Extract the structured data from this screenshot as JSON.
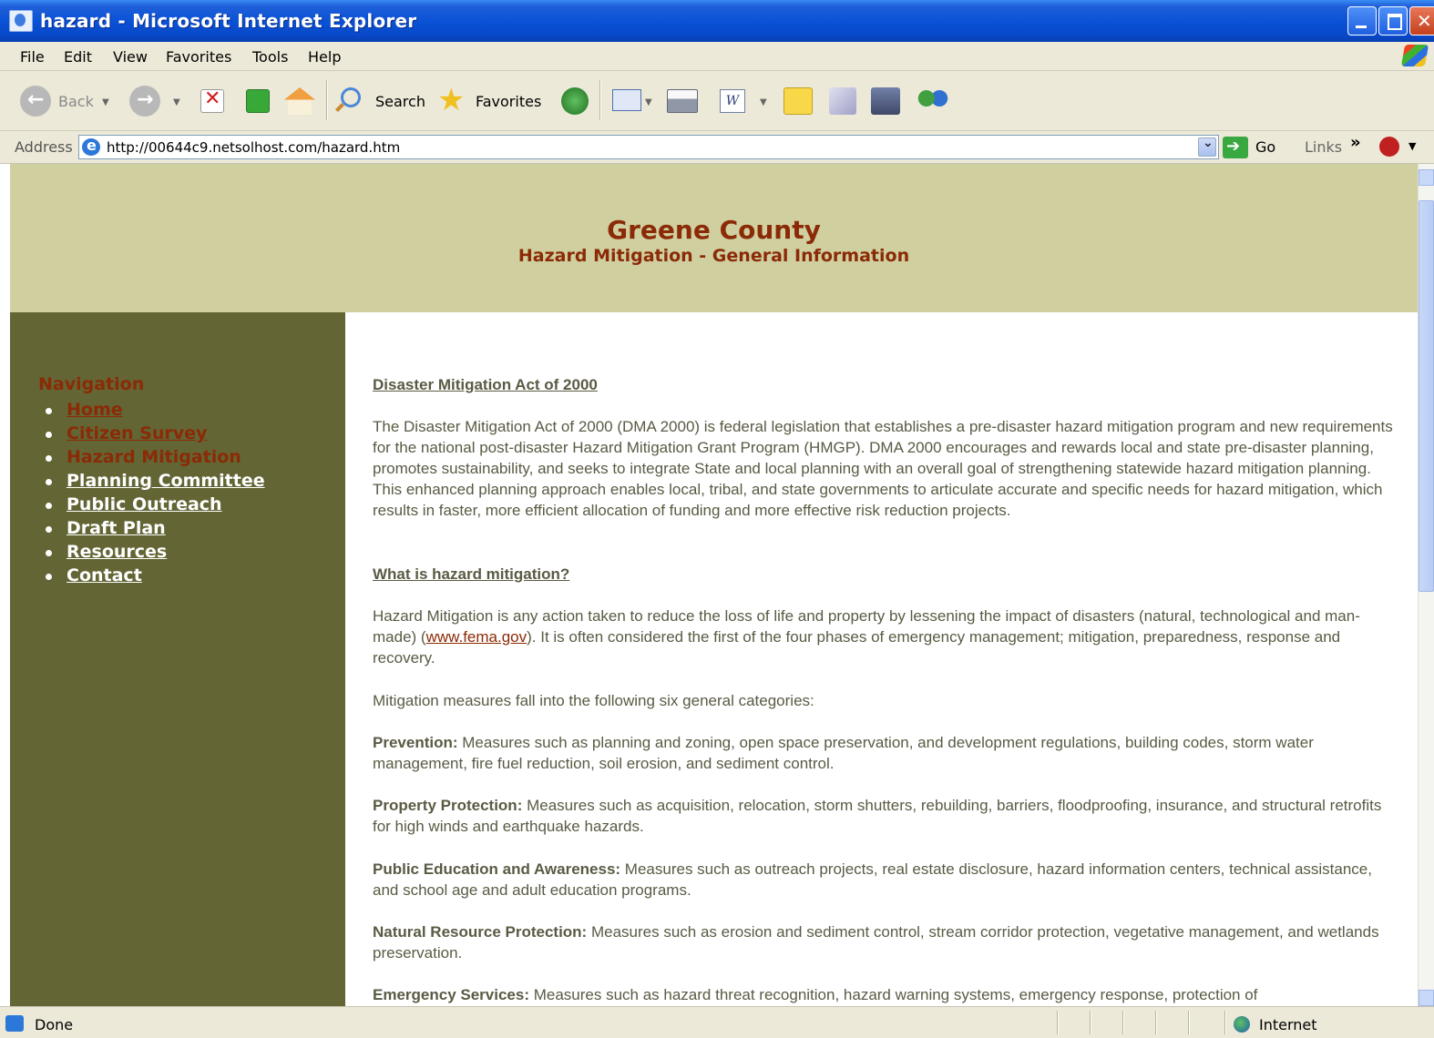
{
  "window": {
    "title": "hazard - Microsoft Internet Explorer"
  },
  "menu": [
    "File",
    "Edit",
    "View",
    "Favorites",
    "Tools",
    "Help"
  ],
  "toolbar": {
    "back": "Back",
    "search": "Search",
    "favorites": "Favorites"
  },
  "address": {
    "label": "Address",
    "url": "http://00644c9.netsolhost.com/hazard.htm",
    "go": "Go",
    "links": "Links"
  },
  "page": {
    "title": "Greene County",
    "subtitle": "Hazard Mitigation - General Information",
    "nav": {
      "title": "Navigation",
      "items": [
        {
          "label": "Home",
          "state": "visited"
        },
        {
          "label": "Citizen Survey",
          "state": "visited"
        },
        {
          "label": "Hazard Mitigation",
          "state": "current"
        },
        {
          "label": "Planning Committee",
          "state": "normal"
        },
        {
          "label": "Public Outreach",
          "state": "normal"
        },
        {
          "label": "Draft Plan",
          "state": "normal"
        },
        {
          "label": "Resources",
          "state": "normal"
        },
        {
          "label": "Contact",
          "state": "normal"
        }
      ]
    },
    "content": {
      "h1": "Disaster Mitigation Act of 2000",
      "p1": "The Disaster Mitigation Act of 2000 (DMA 2000) is federal legislation that establishes a pre-disaster hazard mitigation program and new requirements for the national post-disaster Hazard Mitigation Grant Program (HMGP). DMA 2000 encourages and rewards local and state pre-disaster planning, promotes sustainability, and seeks to integrate State and local planning with an overall goal of strengthening statewide hazard mitigation planning. This enhanced planning approach enables local, tribal, and state governments to articulate accurate and specific needs for hazard mitigation, which results in faster, more efficient allocation of funding and more effective risk reduction projects.",
      "h2": "What is hazard mitigation?",
      "p2_before": "Hazard Mitigation is any action taken to reduce the loss of life and property by lessening the impact of disasters (natural, technological and man-made) (",
      "p2_link": "www.fema.gov",
      "p2_after": "). It is often considered the first of the four phases of emergency management; mitigation, preparedness, response and recovery.",
      "p3": "Mitigation measures fall into the following six general categories:",
      "categories": [
        {
          "name": "Prevention:",
          "text": " Measures such as planning and zoning, open space preservation, and development regulations, building codes, storm water management, fire fuel reduction, soil erosion, and sediment control."
        },
        {
          "name": "Property Protection:",
          "text": " Measures such as acquisition, relocation, storm shutters, rebuilding, barriers, floodproofing, insurance, and structural retrofits for high winds and earthquake hazards."
        },
        {
          "name": "Public Education and Awareness:",
          "text": " Measures such as outreach projects, real estate disclosure, hazard information centers, technical assistance, and school age and adult education programs."
        },
        {
          "name": "Natural Resource Protection:",
          "text": " Measures such as erosion and sediment control, stream corridor protection, vegetative management, and wetlands preservation."
        },
        {
          "name": "Emergency Services:",
          "text": " Measures such as hazard threat recognition, hazard warning systems, emergency response, protection of"
        }
      ]
    }
  },
  "status": {
    "text": "Done",
    "zone": "Internet"
  },
  "colors": {
    "header_bg": "#cfcfa0",
    "sidebar_bg": "#636534",
    "accent": "#8b2a06",
    "body_text": "#5a5a44"
  }
}
